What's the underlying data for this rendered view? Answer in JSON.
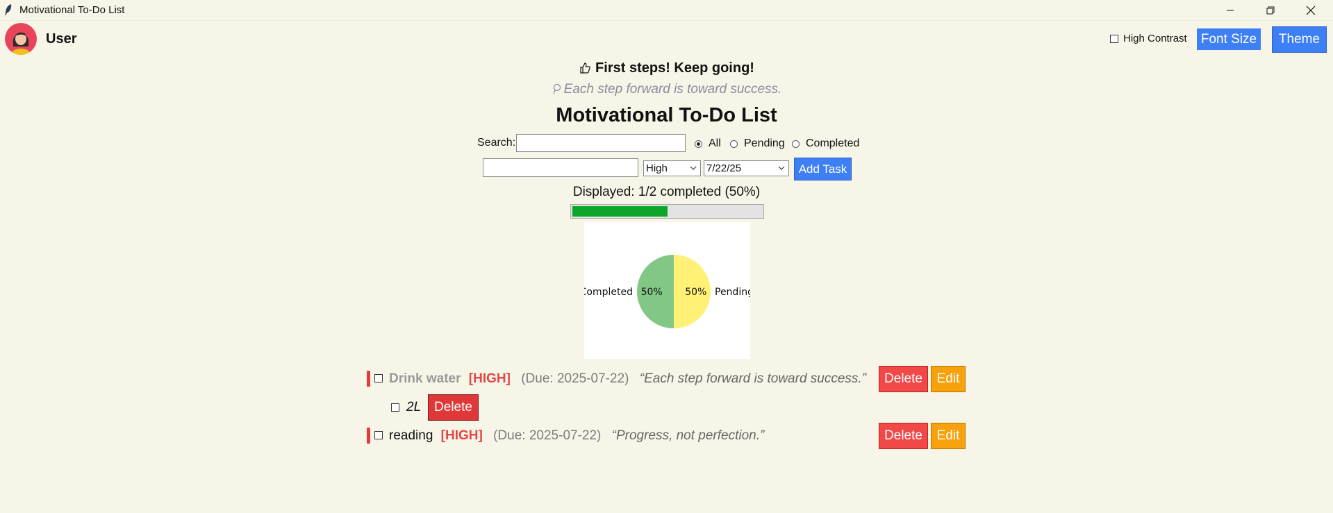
{
  "window": {
    "title": "Motivational To-Do List"
  },
  "header": {
    "username": "User",
    "high_contrast_label": "High Contrast",
    "font_size_label": "Font Size",
    "theme_label": "Theme"
  },
  "motivation": {
    "encouragement": "First steps! Keep going!",
    "encouragement_icon": "thumbs-up-icon",
    "quote": "Each step forward is toward success.",
    "quote_icon": "lightbulb-icon"
  },
  "main": {
    "title": "Motivational To-Do List",
    "search_label": "Search:",
    "search_value": "",
    "filter_options": [
      "All",
      "Pending",
      "Completed"
    ],
    "filter_selected": "All",
    "new_task_value": "",
    "priority_selected": "High",
    "date_selected": "7/22/25",
    "add_task_label": "Add Task",
    "progress_text": "Displayed: 1/2 completed (50%)",
    "progress_fraction": 0.5
  },
  "chart_data": {
    "type": "pie",
    "labels": [
      "Completed",
      "Pending"
    ],
    "values": [
      50,
      50
    ],
    "value_labels": [
      "50%",
      "50%"
    ],
    "colors": [
      "#82c785",
      "#fff176"
    ]
  },
  "tasks": [
    {
      "title": "Drink water",
      "priority": "[HIGH]",
      "due": "(Due: 2025-07-22)",
      "quote": "“Each step forward is toward success.”",
      "completed": true,
      "delete_label": "Delete",
      "edit_label": "Edit",
      "subtasks": [
        {
          "title": "2L",
          "delete_label": "Delete"
        }
      ]
    },
    {
      "title": "reading",
      "priority": "[HIGH]",
      "due": "(Due: 2025-07-22)",
      "quote": "“Progress, not perfection.”",
      "completed": false,
      "delete_label": "Delete",
      "edit_label": "Edit",
      "subtasks": []
    }
  ],
  "colors": {
    "background": "#f7f5e7",
    "accent_blue": "#3d7ff5",
    "delete_red": "#f14848",
    "edit_orange": "#f7a10d",
    "progress_green": "#0da62b",
    "priority_red": "#e54646"
  }
}
